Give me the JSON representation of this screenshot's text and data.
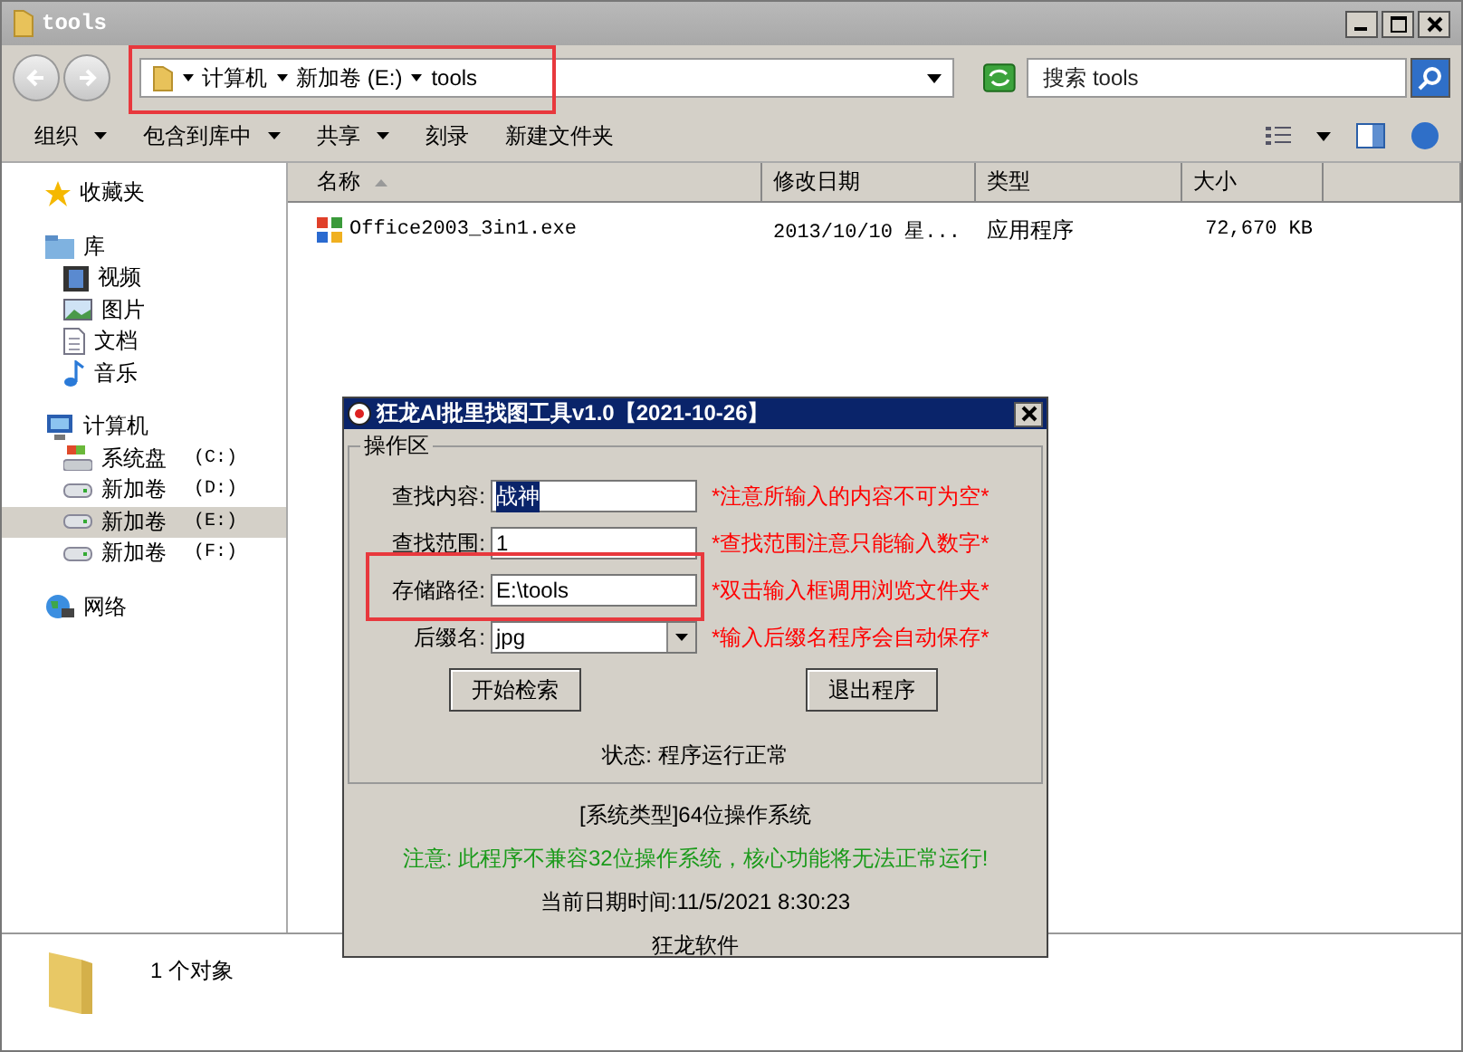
{
  "window": {
    "title": "tools"
  },
  "address": {
    "crumbs": [
      "计算机",
      "新加卷 (E:)",
      "tools"
    ]
  },
  "search": {
    "placeholder": "搜索 tools"
  },
  "toolbar": [
    {
      "label": "组织",
      "dropdown": true
    },
    {
      "label": "包含到库中",
      "dropdown": true
    },
    {
      "label": "共享",
      "dropdown": true
    },
    {
      "label": "刻录",
      "dropdown": false
    },
    {
      "label": "新建文件夹",
      "dropdown": false
    }
  ],
  "sidebar": {
    "groups": [
      {
        "label": "收藏夹",
        "kind": "star"
      },
      {
        "label": "库",
        "kind": "library",
        "children": [
          {
            "label": "视频",
            "kind": "video",
            "selected": false
          },
          {
            "label": "图片",
            "kind": "picture",
            "selected": false
          },
          {
            "label": "文档",
            "kind": "document",
            "selected": false
          },
          {
            "label": "音乐",
            "kind": "music",
            "selected": false
          }
        ]
      },
      {
        "label": "计算机",
        "kind": "computer",
        "children": [
          {
            "label": "系统盘",
            "drive": "(C:)",
            "kind": "system-drive",
            "selected": false
          },
          {
            "label": "新加卷",
            "drive": "(D:)",
            "kind": "drive",
            "selected": false
          },
          {
            "label": "新加卷",
            "drive": "(E:)",
            "kind": "drive",
            "selected": true
          },
          {
            "label": "新加卷",
            "drive": "(F:)",
            "kind": "drive",
            "selected": false
          }
        ]
      },
      {
        "label": "网络",
        "kind": "network"
      }
    ]
  },
  "table": {
    "columns": [
      "名称",
      "修改日期",
      "类型",
      "大小"
    ],
    "rows": [
      {
        "name": "Office2003_3in1.exe",
        "modified": "2013/10/10 星...",
        "type": "应用程序",
        "size": "72,670 KB"
      }
    ]
  },
  "status_bar": {
    "text": "1 个对象"
  },
  "dialog": {
    "title": "狂龙AI批里找图工具v1.0【2021-10-26】",
    "group_label": "操作区",
    "fields": [
      {
        "label": "查找内容:",
        "value": "战神",
        "highlighted": true,
        "kind": "text",
        "hint": "*注意所输入的内容不可为空*"
      },
      {
        "label": "查找范围:",
        "value": "1",
        "highlighted": false,
        "kind": "text",
        "hint": "*查找范围注意只能输入数字*"
      },
      {
        "label": "存储路径:",
        "value": "E:\\tools",
        "highlighted": false,
        "kind": "text",
        "hint": "*双击输入框调用浏览文件夹*"
      },
      {
        "label": "后缀名:",
        "value": "jpg",
        "highlighted": false,
        "kind": "dropdown",
        "hint": "*输入后缀名程序会自动保存*"
      }
    ],
    "buttons": [
      "开始检索",
      "退出程序"
    ],
    "status": "状态: 程序运行正常",
    "lines": [
      {
        "text": "[系统类型]64位操作系统",
        "kind": "normal"
      },
      {
        "text": "注意: 此程序不兼容32位操作系统，核心功能将无法正常运行!",
        "kind": "warning"
      },
      {
        "text": "当前日期时间:11/5/2021 8:30:23",
        "kind": "normal"
      },
      {
        "text": "狂龙软件",
        "kind": "normal"
      }
    ]
  }
}
